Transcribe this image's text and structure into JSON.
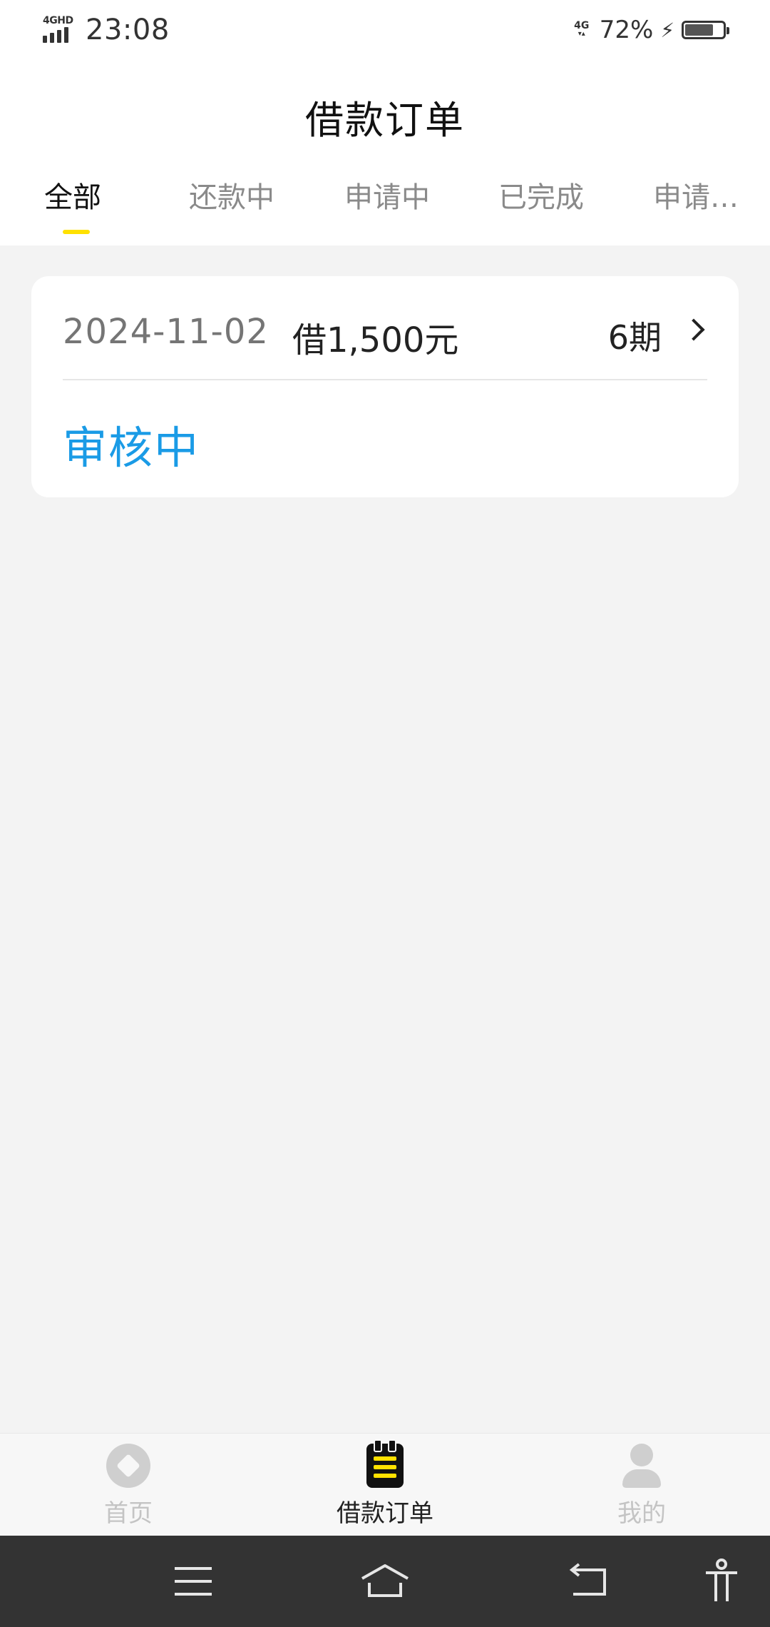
{
  "status_bar": {
    "network_label": "4GHD",
    "time": "23:08",
    "net_right": "4G",
    "battery_percent": "72%",
    "icons": [
      "signal-icon",
      "lightning-icon",
      "battery-icon"
    ]
  },
  "header": {
    "title": "借款订单"
  },
  "tabs": [
    {
      "label": "全部",
      "active": true
    },
    {
      "label": "还款中",
      "active": false
    },
    {
      "label": "申请中",
      "active": false
    },
    {
      "label": "已完成",
      "active": false
    },
    {
      "label": "申请…",
      "active": false
    }
  ],
  "orders": [
    {
      "date": "2024-11-02",
      "amount": "借1,500元",
      "period": "6期",
      "status": "审核中"
    }
  ],
  "tabbar": {
    "items": [
      {
        "label": "首页",
        "icon": "home-diamond-icon",
        "active": false
      },
      {
        "label": "借款订单",
        "icon": "notepad-icon",
        "active": true
      },
      {
        "label": "我的",
        "icon": "user-icon",
        "active": false
      }
    ]
  },
  "colors": {
    "accent_yellow": "#ffe100",
    "status_blue": "#1a9be6",
    "background": "#f3f3f3",
    "nav_bar": "#333333"
  }
}
